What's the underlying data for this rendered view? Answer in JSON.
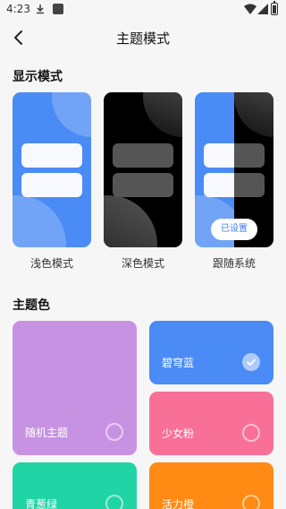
{
  "status_bar": {
    "time": "4:23"
  },
  "header": {
    "title": "主题模式"
  },
  "display_section": {
    "title": "显示模式",
    "modes": [
      {
        "label": "浅色模式",
        "selected": false
      },
      {
        "label": "深色模式",
        "selected": false
      },
      {
        "label": "跟随系统",
        "selected": true,
        "badge": "已设置"
      }
    ]
  },
  "theme_section": {
    "title": "主题色",
    "colors": [
      {
        "label": "随机主题",
        "color": "#c892e3",
        "selected": false
      },
      {
        "label": "碧穹蓝",
        "color": "#4a8bf5",
        "selected": true
      },
      {
        "label": "少女粉",
        "color": "#f87098",
        "selected": false
      },
      {
        "label": "青葱绿",
        "color": "#21d4a5",
        "selected": false
      },
      {
        "label": "活力橙",
        "color": "#ff8a14",
        "selected": false
      }
    ]
  }
}
